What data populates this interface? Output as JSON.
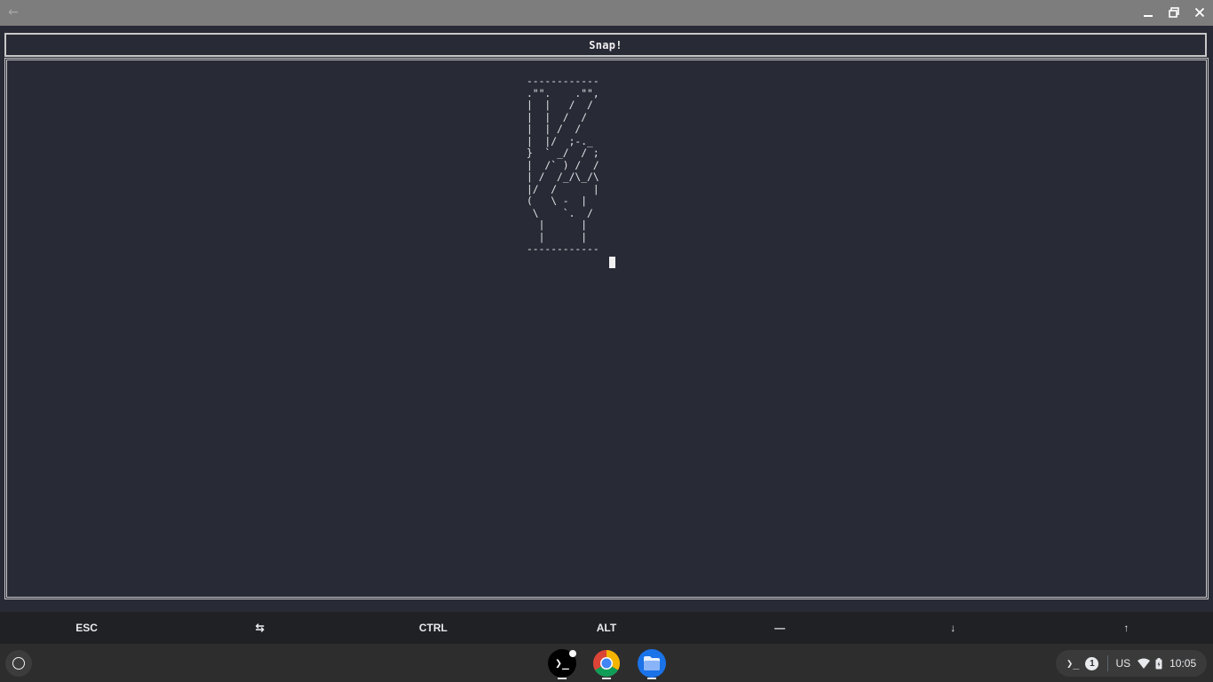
{
  "window": {
    "title": "Snap!",
    "controls": [
      "minimize-icon",
      "restore-icon",
      "close-icon"
    ]
  },
  "terminal": {
    "ascii_art": "------------\n.\"\".    .\"\",\n|  |   /  /\n|  |  /  /\n|  | /  /\n|  |/  ;-._\n}  ` _/  / ;\n|  /` ) /  /\n| /  /_/\\_/\\\n|/  /      |\n(   \\ -  |\n \\    `.  /\n  |      |\n  |      |\n------------"
  },
  "extra_keys": [
    {
      "label": "ESC"
    },
    {
      "label": "⇆"
    },
    {
      "label": "CTRL"
    },
    {
      "label": "ALT"
    },
    {
      "label": "—"
    },
    {
      "label": "↓"
    },
    {
      "label": "↑"
    }
  ],
  "shelf": {
    "apps": [
      "terminal-app",
      "chrome-app",
      "files-app"
    ],
    "tray": {
      "terminal_prompt": "❯_",
      "notification_count": "1",
      "ime": "US",
      "time": "10:05"
    }
  }
}
